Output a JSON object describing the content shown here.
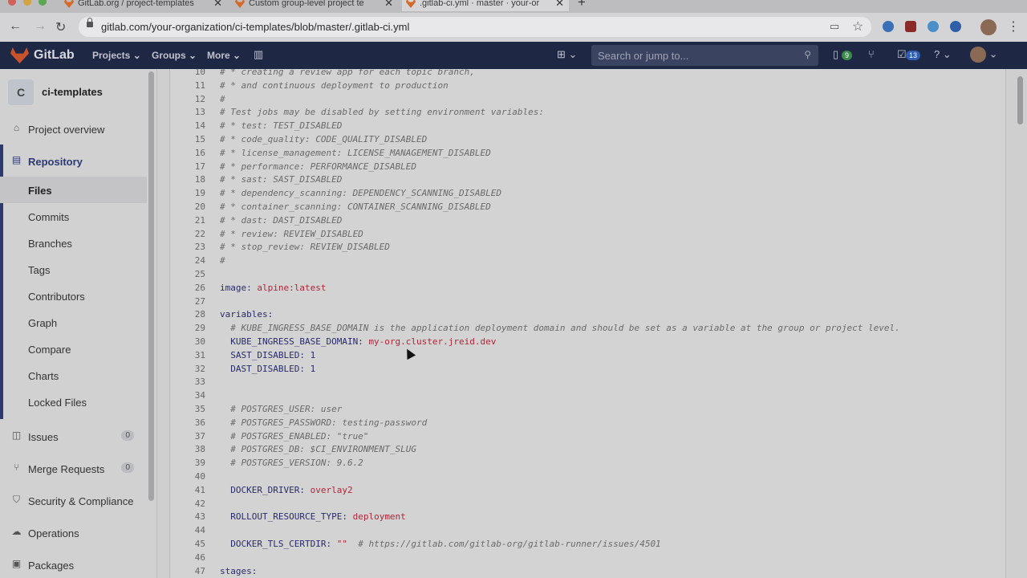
{
  "browser": {
    "tabs": [
      {
        "title": "GitLab.org / project-templates"
      },
      {
        "title": "Custom group-level project te"
      },
      {
        "title": ".gitlab-ci.yml · master · your-or"
      }
    ],
    "url": "gitlab.com/your-organization/ci-templates/blob/master/.gitlab-ci.yml"
  },
  "navbar": {
    "brand": "GitLab",
    "projects": "Projects",
    "groups": "Groups",
    "more": "More",
    "search_placeholder": "Search or jump to...",
    "issues_badge": "9",
    "todos_badge": "13"
  },
  "sidebar": {
    "project_initial": "C",
    "project_name": "ci-templates",
    "overview": "Project overview",
    "repository": "Repository",
    "sub_items": [
      "Files",
      "Commits",
      "Branches",
      "Tags",
      "Contributors",
      "Graph",
      "Compare",
      "Charts",
      "Locked Files"
    ],
    "issues": "Issues",
    "issues_count": "0",
    "merge_requests": "Merge Requests",
    "mr_count": "0",
    "security": "Security & Compliance",
    "operations": "Operations",
    "packages": "Packages"
  },
  "code": {
    "lines": [
      {
        "n": "10",
        "t": "# * creating a review app for each topic branch,",
        "k": "comment"
      },
      {
        "n": "11",
        "t": "# * and continuous deployment to production",
        "k": "comment"
      },
      {
        "n": "12",
        "t": "#",
        "k": "comment"
      },
      {
        "n": "13",
        "t": "# Test jobs may be disabled by setting environment variables:",
        "k": "comment"
      },
      {
        "n": "14",
        "t": "# * test: TEST_DISABLED",
        "k": "comment"
      },
      {
        "n": "15",
        "t": "# * code_quality: CODE_QUALITY_DISABLED",
        "k": "comment"
      },
      {
        "n": "16",
        "t": "# * license_management: LICENSE_MANAGEMENT_DISABLED",
        "k": "comment"
      },
      {
        "n": "17",
        "t": "# * performance: PERFORMANCE_DISABLED",
        "k": "comment"
      },
      {
        "n": "18",
        "t": "# * sast: SAST_DISABLED",
        "k": "comment"
      },
      {
        "n": "19",
        "t": "# * dependency_scanning: DEPENDENCY_SCANNING_DISABLED",
        "k": "comment"
      },
      {
        "n": "20",
        "t": "# * container_scanning: CONTAINER_SCANNING_DISABLED",
        "k": "comment"
      },
      {
        "n": "21",
        "t": "# * dast: DAST_DISABLED",
        "k": "comment"
      },
      {
        "n": "22",
        "t": "# * review: REVIEW_DISABLED",
        "k": "comment"
      },
      {
        "n": "23",
        "t": "# * stop_review: REVIEW_DISABLED",
        "k": "comment"
      },
      {
        "n": "24",
        "t": "#",
        "k": "comment"
      },
      {
        "n": "25",
        "t": "",
        "k": "plain"
      },
      {
        "n": "26",
        "t": "image: ",
        "v": "alpine:latest",
        "k": "kv"
      },
      {
        "n": "27",
        "t": "",
        "k": "plain"
      },
      {
        "n": "28",
        "t": "variables:",
        "k": "key"
      },
      {
        "n": "29",
        "t": "  # KUBE_INGRESS_BASE_DOMAIN is the application deployment domain and should be set as a variable at the group or project level.",
        "k": "comment"
      },
      {
        "n": "30",
        "t": "  KUBE_INGRESS_BASE_DOMAIN: ",
        "v": "my-org.cluster.jreid.dev",
        "k": "kv"
      },
      {
        "n": "31",
        "t": "  SAST_DISABLED: ",
        "v": "1",
        "k": "kvk"
      },
      {
        "n": "32",
        "t": "  DAST_DISABLED: ",
        "v": "1",
        "k": "kvk"
      },
      {
        "n": "33",
        "t": "",
        "k": "plain"
      },
      {
        "n": "34",
        "t": "",
        "k": "plain"
      },
      {
        "n": "35",
        "t": "  # POSTGRES_USER: user",
        "k": "comment"
      },
      {
        "n": "36",
        "t": "  # POSTGRES_PASSWORD: testing-password",
        "k": "comment"
      },
      {
        "n": "37",
        "t": "  # POSTGRES_ENABLED: \"true\"",
        "k": "comment"
      },
      {
        "n": "38",
        "t": "  # POSTGRES_DB: $CI_ENVIRONMENT_SLUG",
        "k": "comment"
      },
      {
        "n": "39",
        "t": "  # POSTGRES_VERSION: 9.6.2",
        "k": "comment"
      },
      {
        "n": "40",
        "t": "",
        "k": "plain"
      },
      {
        "n": "41",
        "t": "  DOCKER_DRIVER: ",
        "v": "overlay2",
        "k": "kv"
      },
      {
        "n": "42",
        "t": "",
        "k": "plain"
      },
      {
        "n": "43",
        "t": "  ROLLOUT_RESOURCE_TYPE: ",
        "v": "deployment",
        "k": "kv"
      },
      {
        "n": "44",
        "t": "",
        "k": "plain"
      },
      {
        "n": "45",
        "t": "  DOCKER_TLS_CERTDIR: ",
        "v": "\"\"",
        "c": "  # https://gitlab.com/gitlab-org/gitlab-runner/issues/4501",
        "k": "kvc"
      },
      {
        "n": "46",
        "t": "",
        "k": "plain"
      },
      {
        "n": "47",
        "t": "stages:",
        "k": "key"
      }
    ]
  }
}
